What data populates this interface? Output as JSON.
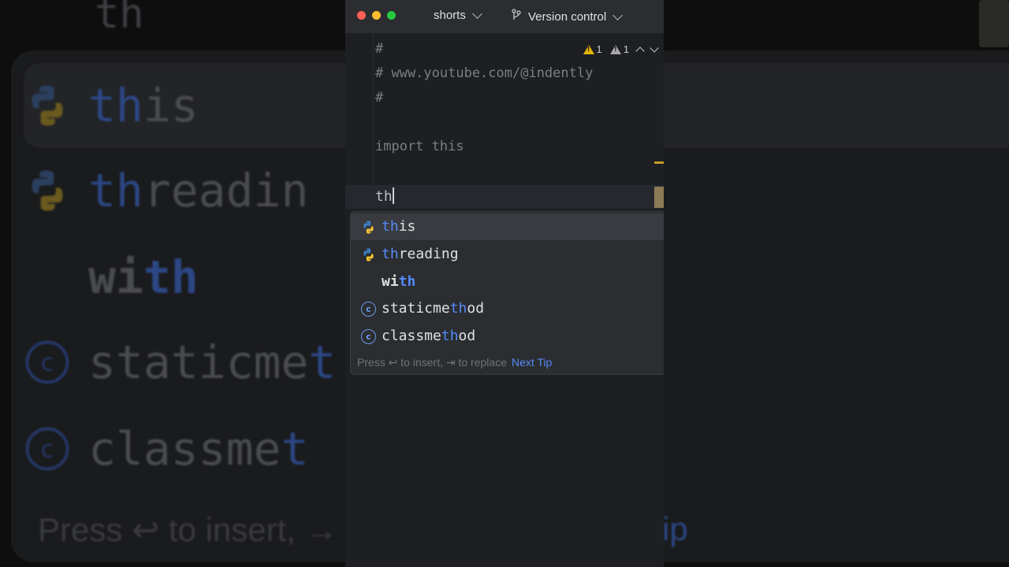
{
  "background": {
    "top_text": "th",
    "rows": [
      {
        "match": "th",
        "rest": "is",
        "icon": "python-icon"
      },
      {
        "match": "th",
        "rest": "readin",
        "icon": "python-icon"
      },
      {
        "prefix": "wi",
        "match": "th",
        "icon": ""
      },
      {
        "prefix": "staticme",
        "match": "t",
        "icon": "class-c-icon"
      },
      {
        "prefix": "classme",
        "match": "t",
        "icon": "class-c-icon"
      }
    ],
    "hint": "Press ↩ to insert, →",
    "hint_link": "ip"
  },
  "titlebar": {
    "project": "shorts",
    "version_control": "Version control"
  },
  "inspections": {
    "warnings": "1",
    "weak_warnings": "1"
  },
  "editor": {
    "lines": [
      "#",
      "# www.youtube.com/@indently",
      "#",
      "import this"
    ],
    "typed": "th"
  },
  "completion": {
    "items": [
      {
        "prefix": "",
        "match": "th",
        "suffix": "is",
        "icon": "python-icon"
      },
      {
        "prefix": "",
        "match": "th",
        "suffix": "reading",
        "icon": "python-icon"
      },
      {
        "prefix": "wi",
        "match": "th",
        "suffix": "",
        "icon": "keyword"
      },
      {
        "prefix": "staticme",
        "match": "th",
        "suffix": "od",
        "icon": "class-c-icon",
        "icon_glyph": "c"
      },
      {
        "prefix": "classme",
        "match": "th",
        "suffix": "od",
        "icon": "class-c-icon",
        "icon_glyph": "c"
      }
    ],
    "hint": "Press ↩ to insert, ⇥ to replace",
    "next_tip": "Next Tip"
  },
  "colors": {
    "match_highlight": "#548af7",
    "editor_bg": "#1e1f22",
    "popup_bg": "#2b2d30"
  }
}
